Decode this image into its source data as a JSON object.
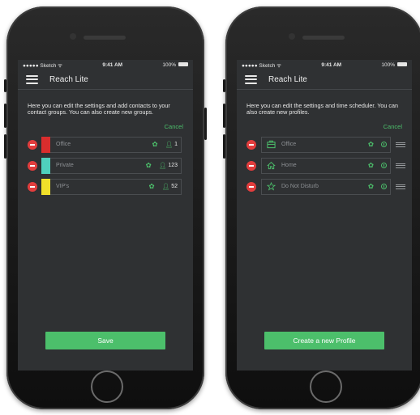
{
  "status": {
    "carrier": "●●●●● Sketch ᯤ",
    "time": "9:41 AM",
    "battery": "100%"
  },
  "left": {
    "app_title": "Reach Lite",
    "description": "Here you can edit the settings and add contacts to your contact groups. You can also create new groups.",
    "cancel_label": "Cancel",
    "groups": [
      {
        "name": "Office",
        "count": "1",
        "color": "#d92d2d"
      },
      {
        "name": "Private",
        "count": "123",
        "color": "#4fd0bd"
      },
      {
        "name": "VIP's",
        "count": "52",
        "color": "#f0e02a"
      }
    ],
    "save_label": "Save"
  },
  "right": {
    "app_title": "Reach Lite",
    "description": "Here you can edit the settings and time scheduler. You can also create new profiles.",
    "cancel_label": "Cancel",
    "profiles": [
      {
        "name": "Office",
        "icon": "briefcase-icon"
      },
      {
        "name": "Home",
        "icon": "home-icon"
      },
      {
        "name": "Do Not Disturb",
        "icon": "star-icon"
      }
    ],
    "create_label": "Create a new Profile"
  },
  "colors": {
    "accent": "#4cbf6b",
    "delete": "#e23d3d",
    "screen_bg": "#2f3133"
  }
}
